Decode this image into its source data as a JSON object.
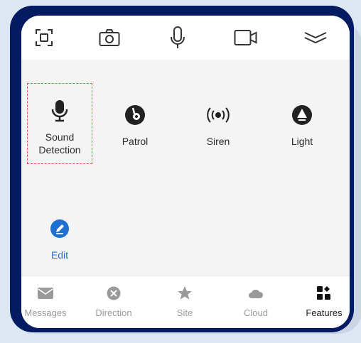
{
  "toolbar": {
    "icons": [
      "screenshot-icon",
      "camera-icon",
      "microphone-icon",
      "video-record-icon",
      "collapse-chevron-icon"
    ]
  },
  "features": {
    "items": [
      {
        "label_line1": "Sound",
        "label_line2": "Detection",
        "icon": "microphone-icon"
      },
      {
        "label": "Patrol",
        "icon": "patrol-icon"
      },
      {
        "label": "Siren",
        "icon": "siren-icon"
      },
      {
        "label": "Light",
        "icon": "light-icon"
      }
    ],
    "edit": {
      "label": "Edit",
      "icon": "pencil-icon"
    }
  },
  "tabbar": {
    "tabs": [
      {
        "label": "Messages",
        "icon": "envelope-icon"
      },
      {
        "label": "Direction",
        "icon": "direction-icon"
      },
      {
        "label": "Site",
        "icon": "star-icon"
      },
      {
        "label": "Cloud",
        "icon": "cloud-icon"
      },
      {
        "label": "Features",
        "icon": "grid-icon"
      }
    ],
    "active": "Features"
  },
  "colors": {
    "frame": "#041a63",
    "accent": "#1e6fd0",
    "selection_border": "#f05a4a"
  }
}
